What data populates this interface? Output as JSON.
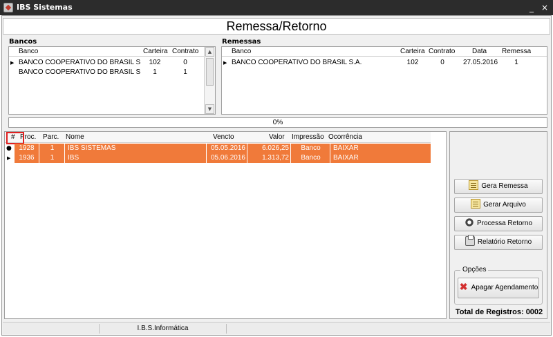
{
  "window": {
    "title": "IBS Sistemas",
    "minimize": "_",
    "close": "×"
  },
  "header": {
    "title": "Remessa/Retorno"
  },
  "bancos": {
    "label": "Bancos",
    "columns": {
      "banco": "Banco",
      "carteira": "Carteira",
      "contrato": "Contrato"
    },
    "rows": [
      {
        "banco": "BANCO COOPERATIVO DO BRASIL S",
        "carteira": "102",
        "contrato": "0"
      },
      {
        "banco": "BANCO COOPERATIVO DO BRASIL S",
        "carteira": "1",
        "contrato": "1"
      }
    ]
  },
  "remessas": {
    "label": "Remessas",
    "columns": {
      "banco": "Banco",
      "carteira": "Carteira",
      "contrato": "Contrato",
      "data": "Data",
      "remessa": "Remessa"
    },
    "rows": [
      {
        "banco": "BANCO COOPERATIVO DO BRASIL S.A.",
        "carteira": "102",
        "contrato": "0",
        "data": "27.05.2016",
        "remessa": "1"
      }
    ]
  },
  "progress": {
    "text": "0%",
    "value": 0
  },
  "main_grid": {
    "columns": {
      "hash": "#",
      "proc": "Proc.",
      "parc": "Parc.",
      "nome": "Nome",
      "vencto": "Vencto",
      "valor": "Valor",
      "impressao": "Impressão",
      "ocorrencia": "Ocorrência"
    },
    "rows": [
      {
        "proc": "1928",
        "parc": "1",
        "nome": "IBS SISTEMAS",
        "vencto": "05.05.2016",
        "valor": "6.026,25",
        "impressao": "Banco",
        "ocorrencia": "BAIXAR"
      },
      {
        "proc": "1936",
        "parc": "1",
        "nome": "IBS",
        "vencto": "05.06.2016",
        "valor": "1.313,72",
        "impressao": "Banco",
        "ocorrencia": "BAIXAR"
      }
    ],
    "row_color": "#f07a3a",
    "highlight_color": "#e02020"
  },
  "actions": {
    "gera_remessa": "Gera Remessa",
    "gerar_arquivo": "Gerar Arquivo",
    "processa_retorno": "Processa Retorno",
    "relatorio_retorno": "Relatório Retorno"
  },
  "opcoes": {
    "label": "Opções",
    "apagar": "Apagar Agendamento"
  },
  "total": {
    "text": "Total de Registros: 0002"
  },
  "status": {
    "company": "I.B.S.Informática"
  }
}
